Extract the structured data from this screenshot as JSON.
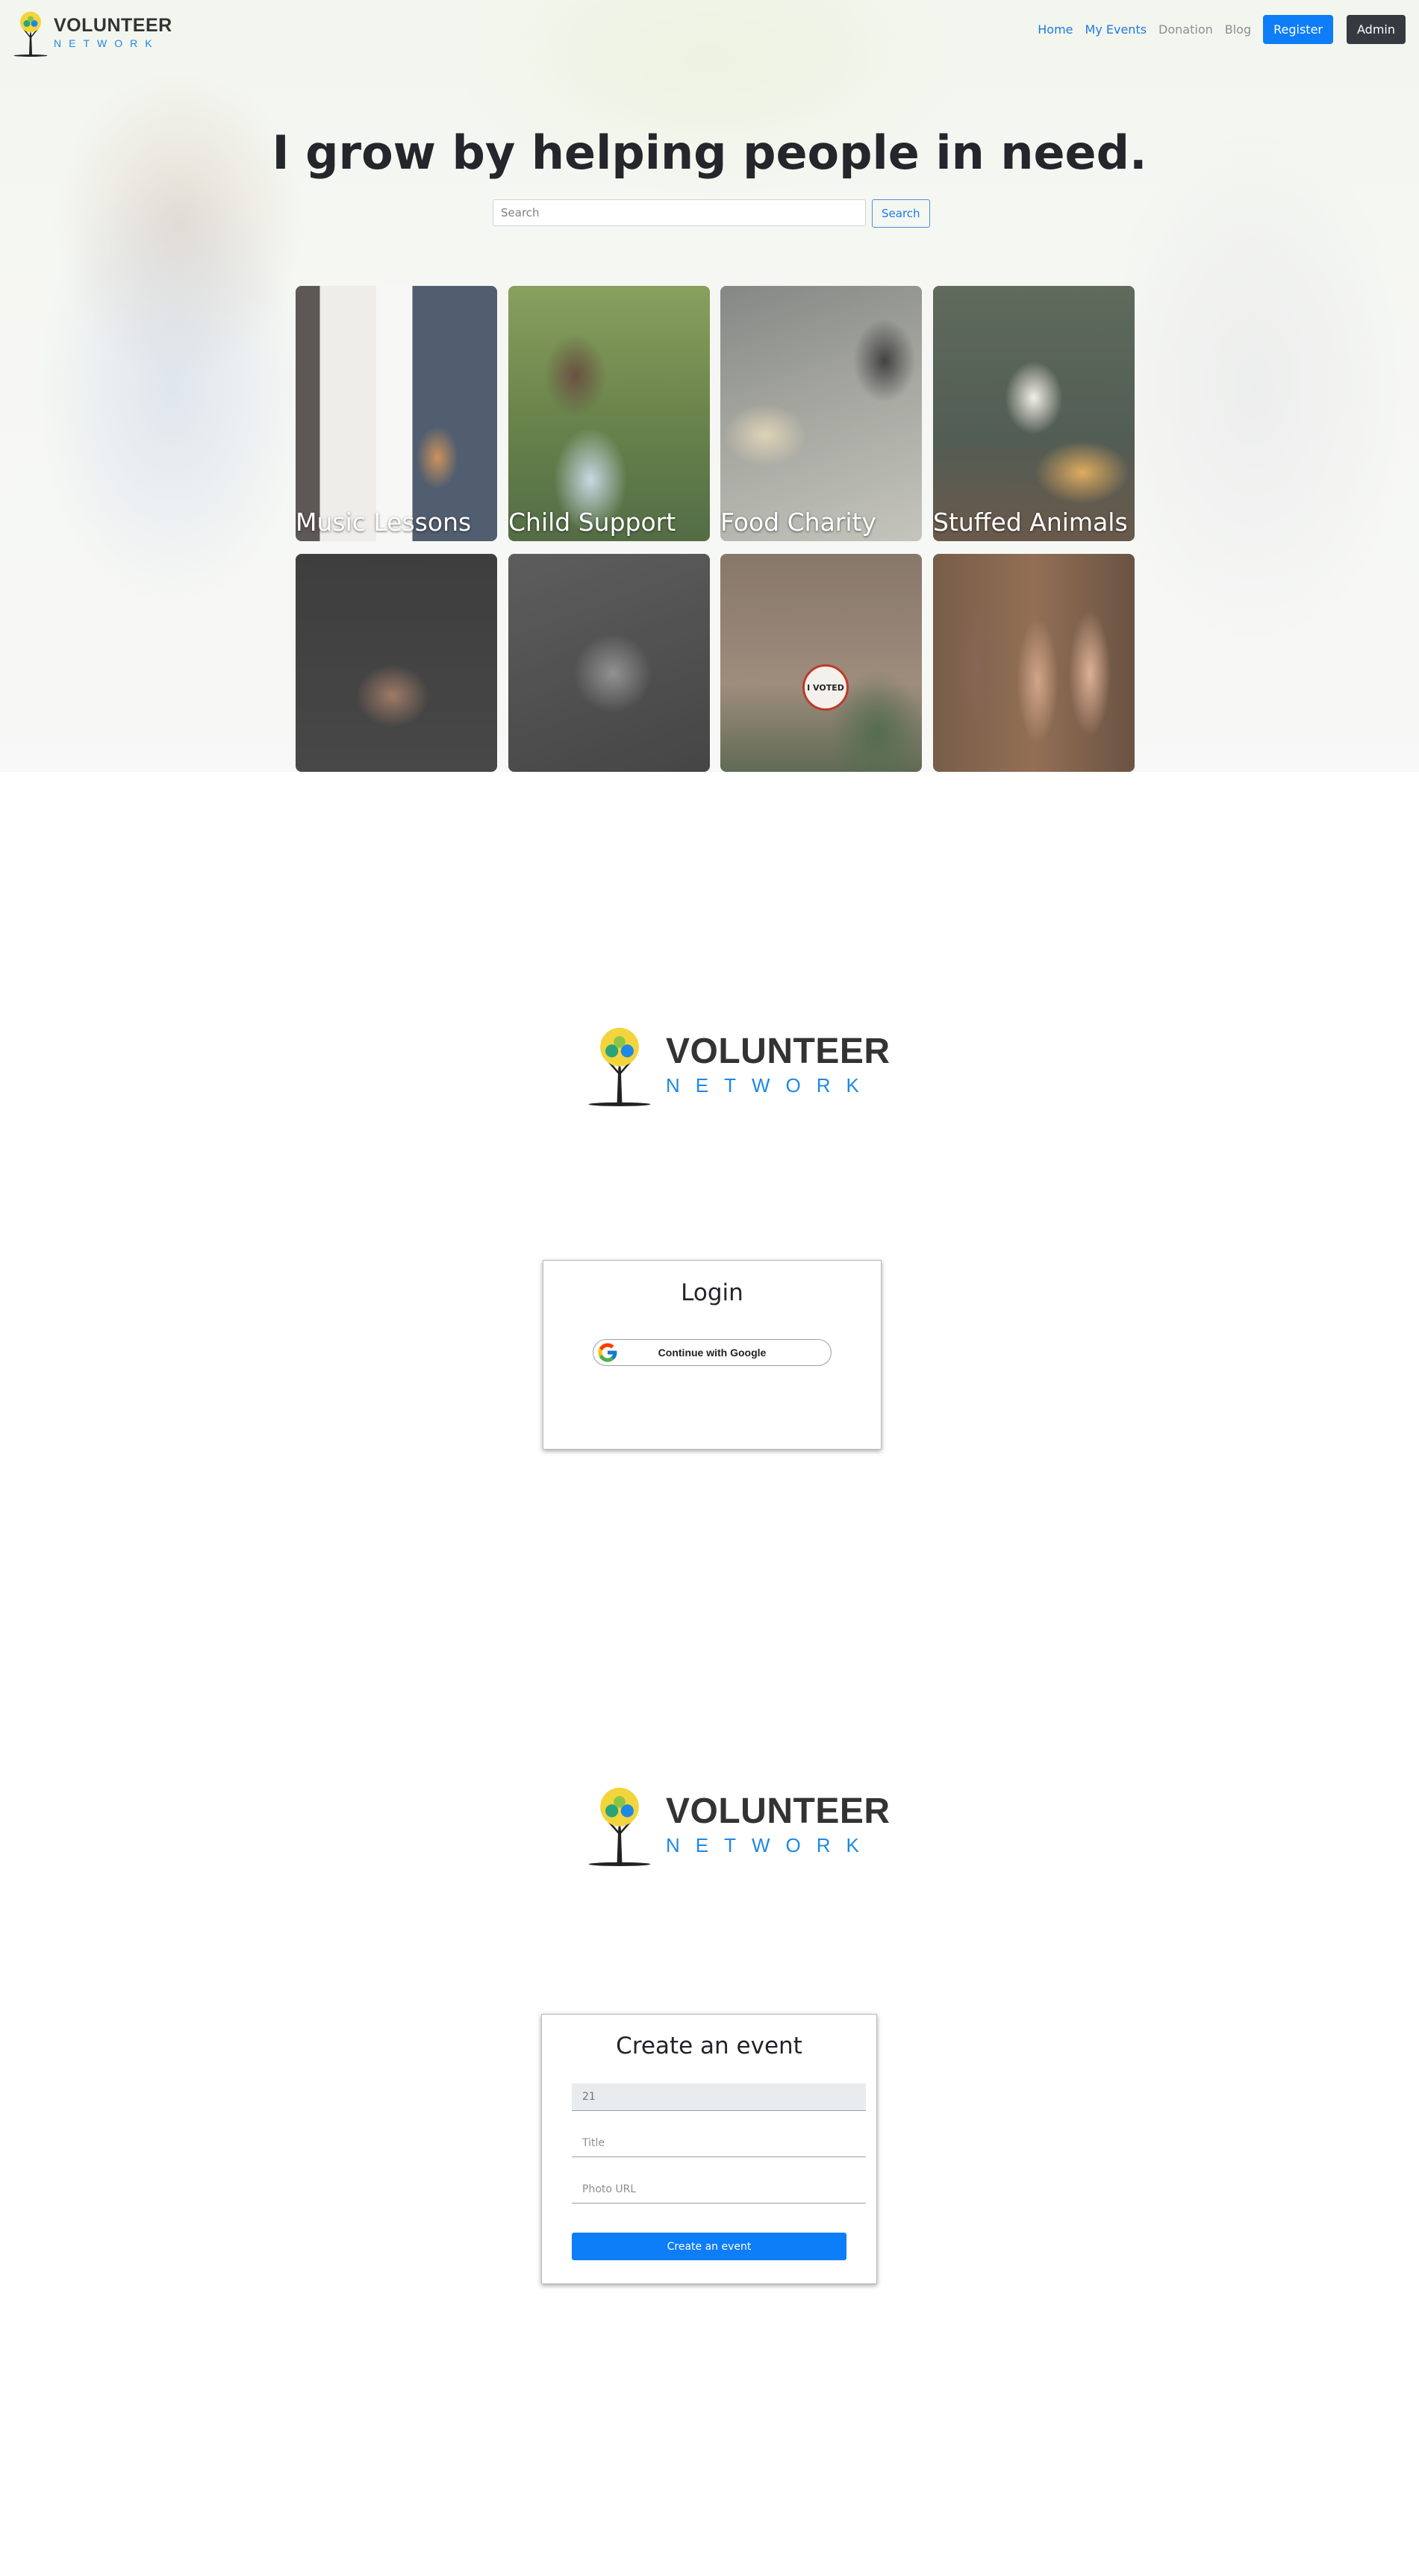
{
  "brand": {
    "title": "VOLUNTEER",
    "subtitle": "NETWORK"
  },
  "nav": {
    "home": "Home",
    "my_events": "My Events",
    "donation": "Donation",
    "blog": "Blog",
    "register": "Register",
    "admin": "Admin"
  },
  "hero": {
    "title": "I grow by helping people in need.",
    "search_placeholder": "Search",
    "search_button": "Search"
  },
  "cards": [
    {
      "label": "Music Lessons"
    },
    {
      "label": "Child Support"
    },
    {
      "label": "Food Charity"
    },
    {
      "label": "Stuffed Animals"
    },
    {
      "label": ""
    },
    {
      "label": ""
    },
    {
      "label": "",
      "badge": "I VOTED"
    },
    {
      "label": ""
    }
  ],
  "login": {
    "title": "Login",
    "google_button": "Continue with Google"
  },
  "create_event": {
    "title": "Create an event",
    "id_value": "21",
    "title_placeholder": "Title",
    "photo_placeholder": "Photo URL",
    "submit": "Create an event"
  }
}
